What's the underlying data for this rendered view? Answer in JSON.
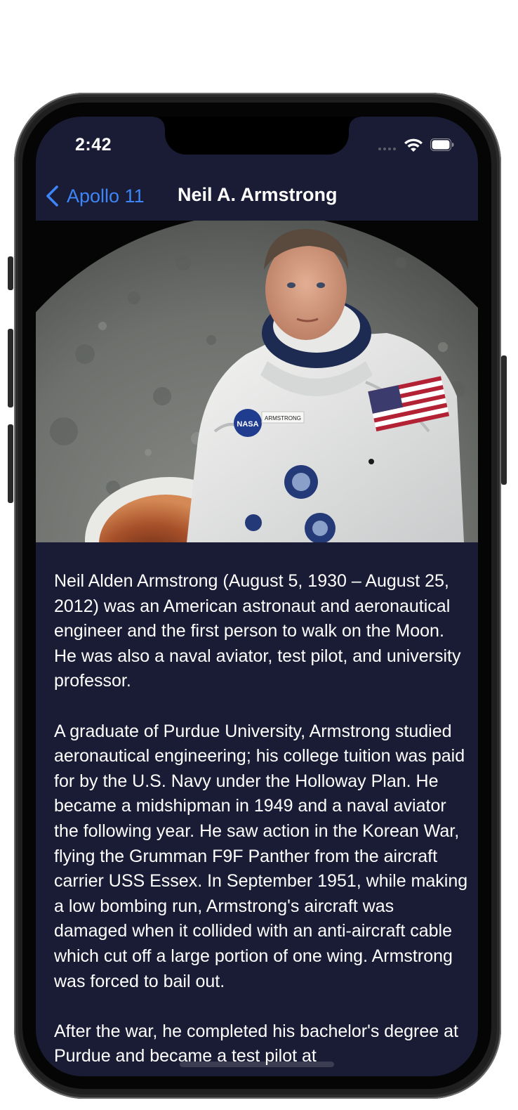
{
  "status_bar": {
    "time": "2:42"
  },
  "nav": {
    "back_label": "Apollo 11",
    "title": "Neil A. Armstrong"
  },
  "hero": {
    "nameplate": "ARMSTRONG",
    "patch_text": "NASA"
  },
  "article": {
    "paragraphs": [
      "Neil Alden Armstrong (August 5, 1930 – August 25, 2012) was an American astronaut and aeronautical engineer and the first person to walk on the Moon. He was also a naval aviator, test pilot, and university professor.",
      "A graduate of Purdue University, Armstrong studied aeronautical engineering; his college tuition was paid for by the U.S. Navy under the Holloway Plan. He became a midshipman in 1949 and a naval aviator the following year. He saw action in the Korean War, flying the Grumman F9F Panther from the aircraft carrier USS Essex. In September 1951, while making a low bombing run, Armstrong's aircraft was damaged when it collided with an anti-aircraft cable which cut off a large portion of one wing. Armstrong was forced to bail out.",
      "After the war, he completed his bachelor's degree at Purdue and became a test pilot at"
    ]
  },
  "colors": {
    "screen_background": "#1a1b34",
    "accent": "#3c86f7",
    "text": "#ffffff"
  },
  "icons": {
    "back": "chevron-left-icon",
    "wifi": "wifi-icon",
    "battery": "battery-icon",
    "signal": "cellular-signal-icon"
  }
}
